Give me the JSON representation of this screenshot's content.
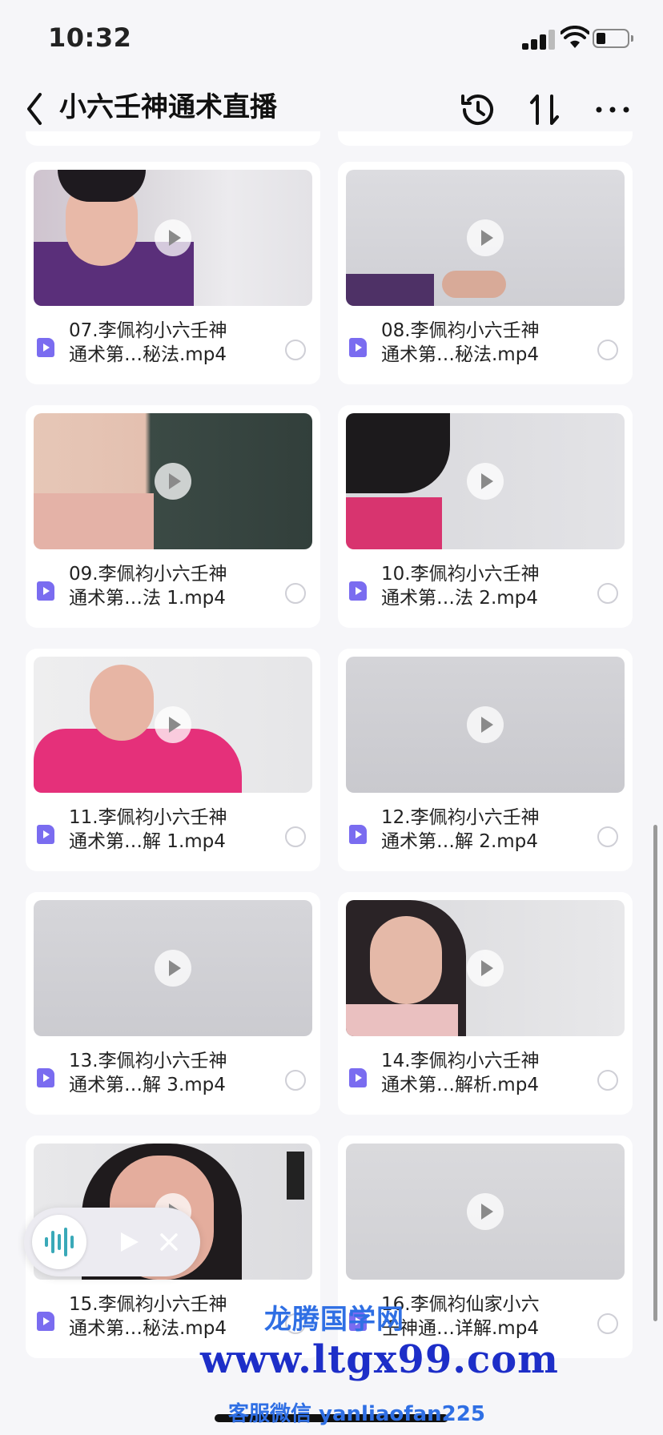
{
  "status_bar": {
    "time": "10:32"
  },
  "header": {
    "title": "小六壬神通术直播"
  },
  "files": [
    {
      "name": "07.李佩袀小六壬神\n通术第…秘法.mp4",
      "thumb": "purple"
    },
    {
      "name": "08.李佩袀小六壬神\n通术第…秘法.mp4",
      "thumb": "board-hand"
    },
    {
      "name": "09.李佩袀小六壬神\n通术第…法 1.mp4",
      "thumb": "blackboard"
    },
    {
      "name": "10.李佩袀小六壬神\n通术第…法 2.mp4",
      "thumb": "pink-writing"
    },
    {
      "name": "11.李佩袀小六壬神\n通术第…解 1.mp4",
      "thumb": "pink"
    },
    {
      "name": "12.李佩袀小六壬神\n通术第…解 2.mp4",
      "thumb": "board"
    },
    {
      "name": "13.李佩袀小六壬神\n通术第…解 3.mp4",
      "thumb": "board"
    },
    {
      "name": "14.李佩袀小六壬神\n通术第…解析.mp4",
      "thumb": "face"
    },
    {
      "name": "15.李佩袀小六壬神\n通术第…秘法.mp4",
      "thumb": "closeup"
    },
    {
      "name": "16.李佩袀仙家小六\n壬神通…详解.mp4",
      "thumb": "board"
    }
  ],
  "watermark": {
    "line1": "龙腾国学网",
    "line2": "www.ltgx99.com",
    "line3": "客服微信 yanliaofan225"
  },
  "colors": {
    "accent": "#7a6cf0",
    "background": "#f6f6f9"
  }
}
